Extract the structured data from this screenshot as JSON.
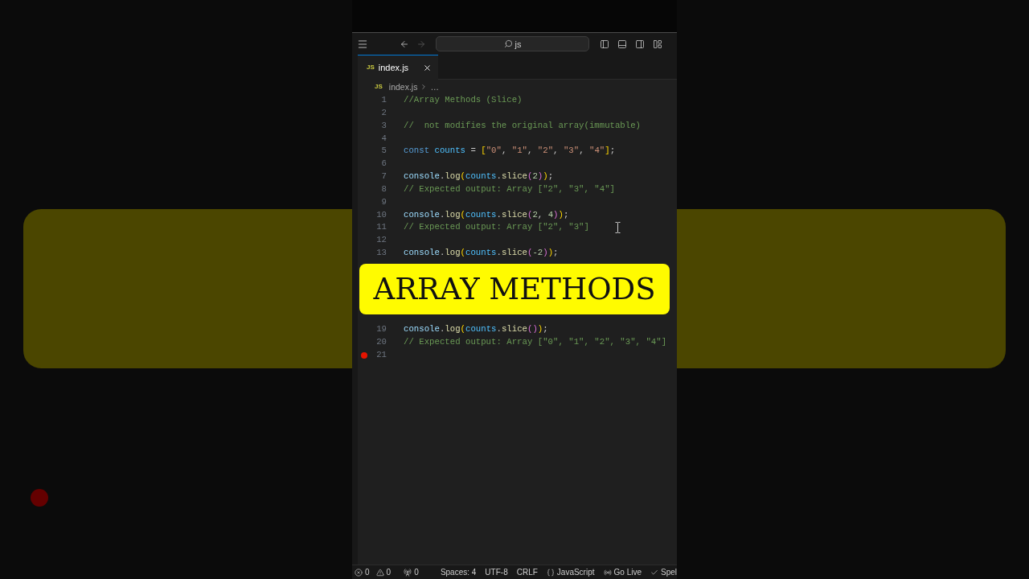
{
  "titlebar": {
    "nav_buttons": [
      {
        "kind": "back",
        "disabled": false
      },
      {
        "kind": "forward",
        "disabled": true
      }
    ],
    "search": {
      "value": "js"
    }
  },
  "tabs": [
    {
      "file_badge": "JS",
      "label": "index.js",
      "selected": true
    }
  ],
  "breadcrumb": {
    "file_badge": "JS",
    "items": [
      "index.js",
      "…"
    ]
  },
  "editor": {
    "lines": [
      {
        "number": "1",
        "breakpoint": false,
        "tokens": [
          {
            "kind": "comment",
            "text": "//Array Methods (Slice)"
          }
        ]
      },
      {
        "number": "2",
        "breakpoint": false
      },
      {
        "number": "3",
        "breakpoint": false,
        "tokens": [
          {
            "kind": "comment",
            "text": "//  not modifies the original array(immutable)"
          }
        ]
      },
      {
        "number": "4",
        "breakpoint": false
      },
      {
        "number": "5",
        "breakpoint": false,
        "tokens": [
          {
            "kind": "keyword",
            "text": "const"
          },
          {
            "kind": "constant",
            "text": " counts"
          },
          {
            "kind": "punct",
            "text": " = "
          },
          {
            "kind": "bracket1",
            "text": "["
          },
          {
            "kind": "string",
            "text": "\"0\""
          },
          {
            "kind": "punct",
            "text": ", "
          },
          {
            "kind": "string",
            "text": "\"1\""
          },
          {
            "kind": "punct",
            "text": ", "
          },
          {
            "kind": "string",
            "text": "\"2\""
          },
          {
            "kind": "punct",
            "text": ", "
          },
          {
            "kind": "string",
            "text": "\"3\""
          },
          {
            "kind": "punct",
            "text": ", "
          },
          {
            "kind": "string",
            "text": "\"4\""
          },
          {
            "kind": "bracket1",
            "text": "]"
          },
          {
            "kind": "punct",
            "text": ";"
          }
        ]
      },
      {
        "number": "6",
        "breakpoint": false
      },
      {
        "number": "7",
        "breakpoint": false,
        "tokens": [
          {
            "kind": "variable",
            "text": "console"
          },
          {
            "kind": "punct",
            "text": "."
          },
          {
            "kind": "function",
            "text": "log"
          },
          {
            "kind": "bracket1",
            "text": "("
          },
          {
            "kind": "constant",
            "text": "counts"
          },
          {
            "kind": "punct",
            "text": "."
          },
          {
            "kind": "function",
            "text": "slice"
          },
          {
            "kind": "bracket2",
            "text": "("
          },
          {
            "kind": "number",
            "text": "2"
          },
          {
            "kind": "bracket2",
            "text": ")"
          },
          {
            "kind": "bracket1",
            "text": ")"
          },
          {
            "kind": "punct",
            "text": ";"
          }
        ]
      },
      {
        "number": "8",
        "breakpoint": false,
        "tokens": [
          {
            "kind": "comment",
            "text": "// Expected output: Array [\"2\", \"3\", \"4\"]"
          }
        ]
      },
      {
        "number": "9",
        "breakpoint": false
      },
      {
        "number": "10",
        "breakpoint": false,
        "tokens": [
          {
            "kind": "variable",
            "text": "console"
          },
          {
            "kind": "punct",
            "text": "."
          },
          {
            "kind": "function",
            "text": "log"
          },
          {
            "kind": "bracket1",
            "text": "("
          },
          {
            "kind": "constant",
            "text": "counts"
          },
          {
            "kind": "punct",
            "text": "."
          },
          {
            "kind": "function",
            "text": "slice"
          },
          {
            "kind": "bracket2",
            "text": "("
          },
          {
            "kind": "number",
            "text": "2"
          },
          {
            "kind": "punct",
            "text": ", "
          },
          {
            "kind": "number",
            "text": "4"
          },
          {
            "kind": "bracket2",
            "text": ")"
          },
          {
            "kind": "bracket1",
            "text": ")"
          },
          {
            "kind": "punct",
            "text": ";"
          }
        ]
      },
      {
        "number": "11",
        "breakpoint": false,
        "tokens": [
          {
            "kind": "comment",
            "text": "// Expected output: Array [\"2\", \"3\"]"
          }
        ]
      },
      {
        "number": "12",
        "breakpoint": false
      },
      {
        "number": "13",
        "breakpoint": false,
        "tokens": [
          {
            "kind": "variable",
            "text": "console"
          },
          {
            "kind": "punct",
            "text": "."
          },
          {
            "kind": "function",
            "text": "log"
          },
          {
            "kind": "bracket1",
            "text": "("
          },
          {
            "kind": "constant",
            "text": "counts"
          },
          {
            "kind": "punct",
            "text": "."
          },
          {
            "kind": "function",
            "text": "slice"
          },
          {
            "kind": "bracket2",
            "text": "("
          },
          {
            "kind": "number",
            "text": "-2"
          },
          {
            "kind": "bracket2",
            "text": ")"
          },
          {
            "kind": "bracket1",
            "text": ")"
          },
          {
            "kind": "punct",
            "text": ";"
          }
        ]
      },
      {
        "number": "19",
        "breakpoint": false,
        "tokens": [
          {
            "kind": "variable",
            "text": "console"
          },
          {
            "kind": "punct",
            "text": "."
          },
          {
            "kind": "function",
            "text": "log"
          },
          {
            "kind": "bracket1",
            "text": "("
          },
          {
            "kind": "constant",
            "text": "counts"
          },
          {
            "kind": "punct",
            "text": "."
          },
          {
            "kind": "function",
            "text": "slice"
          },
          {
            "kind": "bracket2",
            "text": "()"
          },
          {
            "kind": "bracket1",
            "text": ")"
          },
          {
            "kind": "punct",
            "text": ";"
          }
        ]
      },
      {
        "number": "20",
        "breakpoint": false,
        "tokens": [
          {
            "kind": "comment",
            "text": "// Expected output: Array [\"0\", \"1\", \"2\", \"3\", \"4\"]"
          }
        ]
      },
      {
        "number": "21",
        "breakpoint": true
      }
    ]
  },
  "banner": {
    "text": "ARRAY METHODS"
  },
  "status_bar": {
    "left": [
      {
        "kind": "errors",
        "text": "0"
      },
      {
        "kind": "warnings",
        "text": "0"
      },
      {
        "kind": "ports",
        "text": "0"
      }
    ],
    "right": [
      {
        "kind": "indentation",
        "text": "Spaces: 4"
      },
      {
        "kind": "encoding",
        "text": "UTF-8"
      },
      {
        "kind": "eol",
        "text": "CRLF"
      },
      {
        "kind": "language",
        "text": "JavaScript"
      },
      {
        "kind": "live",
        "text": "Go Live"
      },
      {
        "kind": "spell",
        "text": "Spel"
      }
    ]
  }
}
